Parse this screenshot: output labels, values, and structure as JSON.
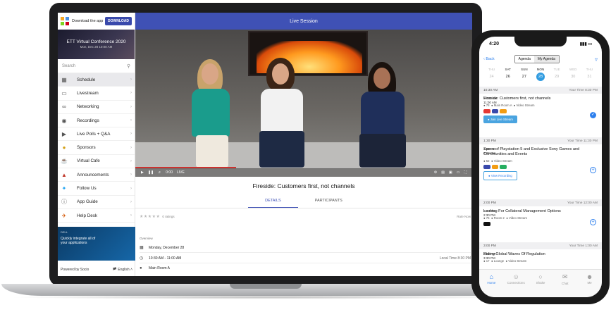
{
  "sidebar": {
    "download_text": "Download the app",
    "download_button": "DOWNLOAD",
    "event_title": "ETT Virtual Conference 2020",
    "event_date": "Mon, Dec 28 10:00 AM",
    "search_placeholder": "Search",
    "items": [
      {
        "label": "Schedule",
        "icon": "calendar-icon"
      },
      {
        "label": "Livestream",
        "icon": "monitor-icon"
      },
      {
        "label": "Networking",
        "icon": "network-icon"
      },
      {
        "label": "Recordings",
        "icon": "recording-icon"
      },
      {
        "label": "Live Polls + Q&A",
        "icon": "polls-icon"
      },
      {
        "label": "Sponsors",
        "icon": "sponsor-icon"
      },
      {
        "label": "Virtual Cafe",
        "icon": "cafe-icon"
      },
      {
        "label": "Announcements",
        "icon": "megaphone-icon"
      },
      {
        "label": "Follow Us",
        "icon": "twitter-icon"
      },
      {
        "label": "App Guide",
        "icon": "info-icon"
      },
      {
        "label": "Help Desk",
        "icon": "help-icon"
      }
    ],
    "ad_brand": "DELL",
    "ad_line1": "Quickly integrate all of",
    "ad_line2": "your applications",
    "powered_by": "Powered by Socio",
    "language": "English"
  },
  "main": {
    "header": "Live Session",
    "video_time": "0:00",
    "video_live": "LIVE",
    "session_title": "Fireside: Customers first, not channels",
    "tabs": [
      "DETAILS",
      "PARTICIPANTS"
    ],
    "ratings_text": "0 ratings",
    "rate_right": "Rate Now",
    "overview_label": "Overview",
    "date": "Monday, December 28",
    "time_range": "10:30 AM - 11:00 AM",
    "local_time": "Local Time 8:30 PM",
    "location": "Main Room A",
    "progress_fraction": 0.3
  },
  "phone": {
    "clock": "4:20",
    "back": "Back",
    "seg_agenda": "Agenda",
    "seg_my_agenda": "My Agenda",
    "days": [
      {
        "dow": "THU",
        "num": "24",
        "state": "light"
      },
      {
        "dow": "SAT",
        "num": "26",
        "state": "dark"
      },
      {
        "dow": "SUN",
        "num": "27",
        "state": "dark"
      },
      {
        "dow": "MON",
        "num": "28",
        "state": "sel"
      },
      {
        "dow": "TUE",
        "num": "29",
        "state": "light"
      },
      {
        "dow": "WED",
        "num": "30",
        "state": "light"
      },
      {
        "dow": "THU",
        "num": "31",
        "state": "light"
      }
    ],
    "slots": [
      {
        "time": "10:30 AM",
        "your_time": "Your Time 8:30 PM"
      },
      {
        "time": "1:30 PM",
        "your_time": "Your Time 11:30 PM"
      },
      {
        "time": "2:00 PM",
        "your_time": "Your Time 12:00 AM"
      },
      {
        "time": "3:00 PM",
        "your_time": "Your Time 1:00 AM"
      }
    ],
    "sessions": [
      {
        "start": "10:30 AM",
        "end": "11:00 AM",
        "title": "Fireside: Customers first, not channels",
        "count": "78",
        "room": "Main Room A",
        "stream": "Video Stream",
        "button": "Join Live Stream"
      },
      {
        "start": "1:30 PM",
        "end": "2:00 PM",
        "title": "Specs of Playstation 5 and Exclusive Sony Games and Communities and Events",
        "count": "52",
        "stream": "Video Stream",
        "button": "View Recording"
      },
      {
        "start": "2:00 PM",
        "end": "2:30 PM",
        "title": "Looking For Collateral Management Options",
        "count": "76",
        "room": "Room 2",
        "stream": "Video Stream"
      },
      {
        "start": "3:00 PM",
        "end": "3:30 PM",
        "title": "Riding Global Waves Of Regulation",
        "count": "17",
        "room": "Lounge",
        "stream": "Video Stream"
      }
    ],
    "tabbar": [
      {
        "label": "Home",
        "icon": "home-icon"
      },
      {
        "label": "Connections",
        "icon": "connections-icon"
      },
      {
        "label": "Shake",
        "icon": "shake-icon"
      },
      {
        "label": "Chat",
        "icon": "chat-icon"
      },
      {
        "label": "Me",
        "icon": "person-icon"
      }
    ]
  }
}
